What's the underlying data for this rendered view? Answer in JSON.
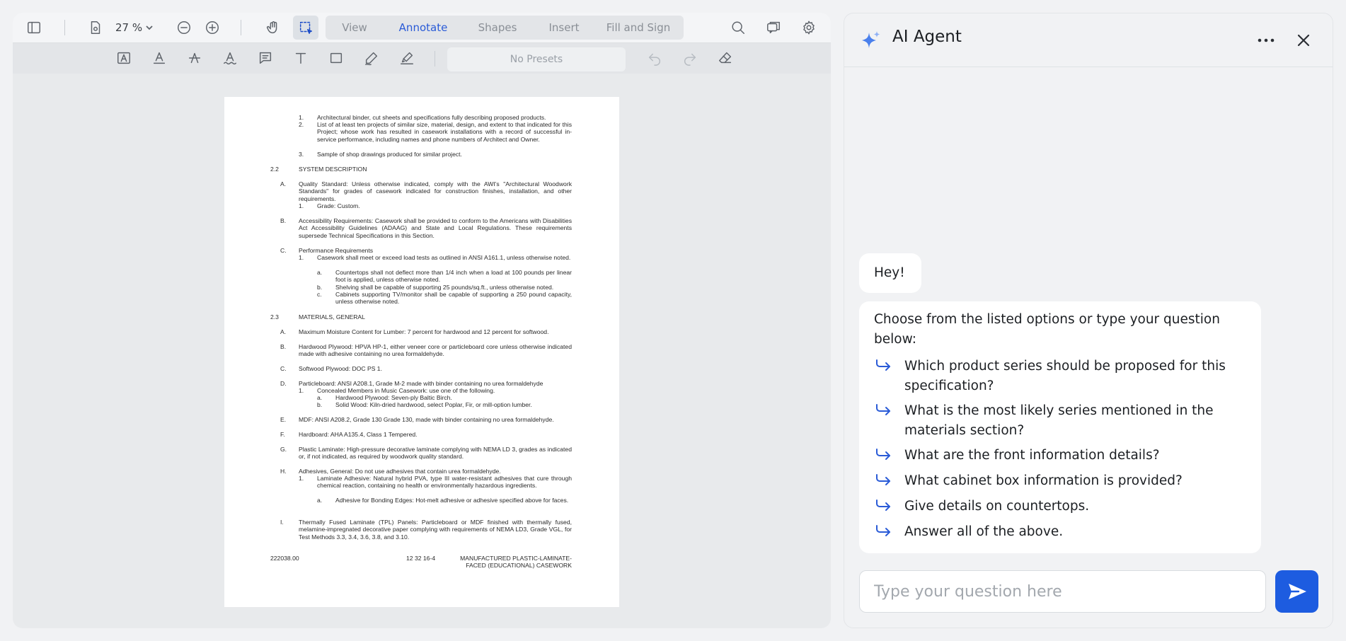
{
  "toolbar": {
    "zoom_value": "27 %",
    "modes": [
      "View",
      "Annotate",
      "Shapes",
      "Insert",
      "Fill and Sign"
    ],
    "selected_mode": "Annotate",
    "presets_label": "No Presets"
  },
  "document": {
    "lines": [
      "1.",
      "Architectural binder, cut sheets and specifications fully describing proposed products.",
      "2.",
      "List of at least ten projects of similar size, material, design, and extent to that indicated for this Project; whose work has resulted in casework installations with a record of successful in-service performance, including names and phone numbers of Architect and Owner.",
      "3.",
      "Sample of shop drawings produced for similar project.",
      "2.2",
      "SYSTEM DESCRIPTION",
      "A.",
      "Quality Standard:  Unless otherwise indicated, comply with the AWI's \"Architectural Woodwork Standards\" for grades of casework indicated for construction finishes, installation, and other requirements.",
      "1.",
      "Grade:  Custom.",
      "B.",
      "Accessibility Requirements:  Casework shall be provided to conform to the Americans with Disabilities Act Accessibility Guidelines (ADAAG) and State and Local Regulations.   These requirements supersede Technical Specifications in this Section.",
      "C.",
      "Performance Requirements",
      "1.",
      "Casework shall meet or exceed load tests as outlined in ANSI A161.1, unless otherwise noted.",
      "a.",
      "Countertops shall not deflect more than 1/4 inch when a load at 100 pounds per linear foot is applied, unless otherwise noted.",
      "b.",
      "Shelving shall be capable of supporting 25 pounds/sq.ft., unless otherwise noted.",
      "c.",
      "Cabinets supporting TV/monitor shall be capable of supporting a 250 pound capacity, unless otherwise noted.",
      "2.3",
      "MATERIALS, GENERAL",
      "A.",
      "Maximum Moisture Content for Lumber:  7 percent for hardwood and 12 percent for softwood.",
      "B.",
      "Hardwood Plywood:   HPVA HP-1, either veneer core or particleboard core unless otherwise indicated made with adhesive containing no urea formaldehyde.",
      "C.",
      "Softwood Plywood:  DOC PS 1.",
      "D.",
      "Particleboard:  ANSI A208.1, Grade M-2 made with binder containing no urea formaldehyde",
      "1.",
      "Concealed Members in Music Casework:  use one of the following.",
      "a.",
      "Hardwood Plywood:  Seven-ply Baltic Birch.",
      "b.",
      "Solid Wood:  Kiln-dried hardwood, select Poplar, Fir, or mill-option lumber.",
      "E.",
      "MDF:  ANSI A208.2, Grade 130 Grade 130, made with binder containing no urea formaldehyde.",
      "F.",
      "Hardboard:  AHA A135.4, Class 1 Tempered.",
      "G.",
      "Plastic Laminate:   High-pressure decorative laminate complying with NEMA LD 3, grades as indicated or, if not indicated, as required by woodwork quality standard.",
      "H.",
      "Adhesives, General:  Do not use adhesives that contain urea formaldehyde.",
      "1.",
      "Laminate Adhesive:   Natural hybrid PVA, type III water-resistant adhesives that cure through chemical reaction, containing no health or environmentally hazardous ingredients.",
      "a.",
      "Adhesive for Bonding Edges:  Hot-melt adhesive or adhesive specified above for faces.",
      "I.",
      "Thermally Fused Laminate (TPL) Panels:  Particleboard or MDF finished with thermally fused, melamine-impregnated decorative paper complying with requirements of NEMA LD3, Grade VGL, for Test Methods 3.3, 3.4, 3.6, 3.8, and 3.10."
    ],
    "footer_left": "222038.00",
    "footer_center": "12 32 16-4",
    "footer_right_line1": "MANUFACTURED PLASTIC-LAMINATE-",
    "footer_right_line2": "FACED (EDUCATIONAL) CASEWORK"
  },
  "chat": {
    "title": "AI Agent",
    "greeting": "Hey!",
    "prompt": "Choose from the listed options or type your question below:",
    "options": [
      "Which product series should be proposed for this specification?",
      "What is the most likely series mentioned in the materials section?",
      "What are the front information details?",
      "What cabinet box information is provided?",
      "Give details on countertops.",
      "Answer all of the above."
    ],
    "input_placeholder": "Type your question here"
  },
  "colors": {
    "accent": "#1d5ce0",
    "selected_mode": "#2a5bd7"
  }
}
